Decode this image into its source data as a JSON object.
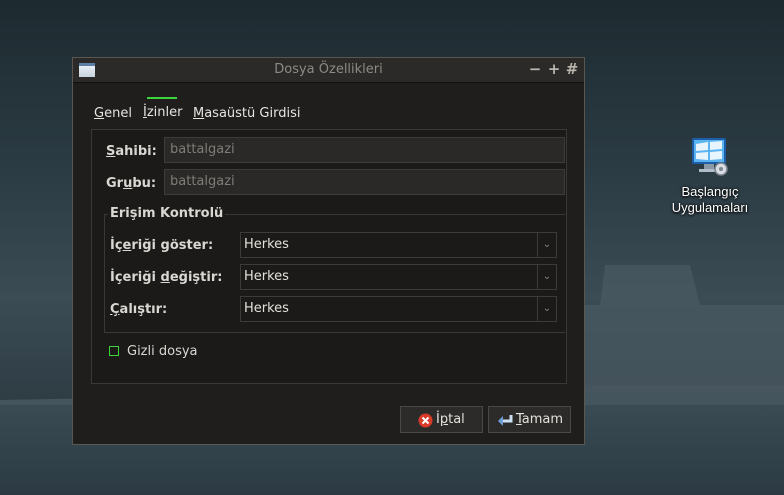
{
  "desktop": {
    "icon_label_line1": "Başlangıç",
    "icon_label_line2": "Uygulamaları"
  },
  "window": {
    "title": "Dosya Özellikleri",
    "controls": {
      "minimize": "−",
      "maximize": "+",
      "pin": "#"
    },
    "tabs": [
      {
        "label_u": "G",
        "label_rest": "enel"
      },
      {
        "label_u": "İ",
        "label_rest": "zinler"
      },
      {
        "label_u": "M",
        "label_rest": "asaüstü Girdisi"
      }
    ],
    "active_tab": "İzinler",
    "owner": {
      "label_u": "S",
      "label_rest": "ahibi:",
      "value": "battalgazi"
    },
    "group": {
      "label_pre": "Gr",
      "label_u": "u",
      "label_rest": "bu:",
      "value": "battalgazi"
    },
    "access_control": {
      "title": "Erişim Kontrolü",
      "view_content": {
        "label_pre": "İç",
        "label_u": "e",
        "label_rest": "riği göster:",
        "value": "Herkes"
      },
      "change_content": {
        "label_pre": "İçeriği ",
        "label_u": "d",
        "label_rest": "eğiştir:",
        "value": "Herkes"
      },
      "execute": {
        "label_u": "Ç",
        "label_rest": "alıştır:",
        "value": "Herkes"
      }
    },
    "hidden_file": {
      "label": "Gizli dosya",
      "checked": false
    },
    "buttons": {
      "cancel": {
        "label_pre": "İ",
        "label_u": "p",
        "label_rest": "tal"
      },
      "ok": {
        "label_u": "T",
        "label_rest": "amam"
      }
    }
  },
  "colors": {
    "accent": "#3cd33c",
    "cancel_icon": "#d93b2b",
    "ok_icon": "#6f9fd8"
  },
  "icons": [
    "window-app-icon",
    "startup-apps-monitor-icon",
    "cancel-icon",
    "ok-enter-icon",
    "chevron-down-icon"
  ]
}
